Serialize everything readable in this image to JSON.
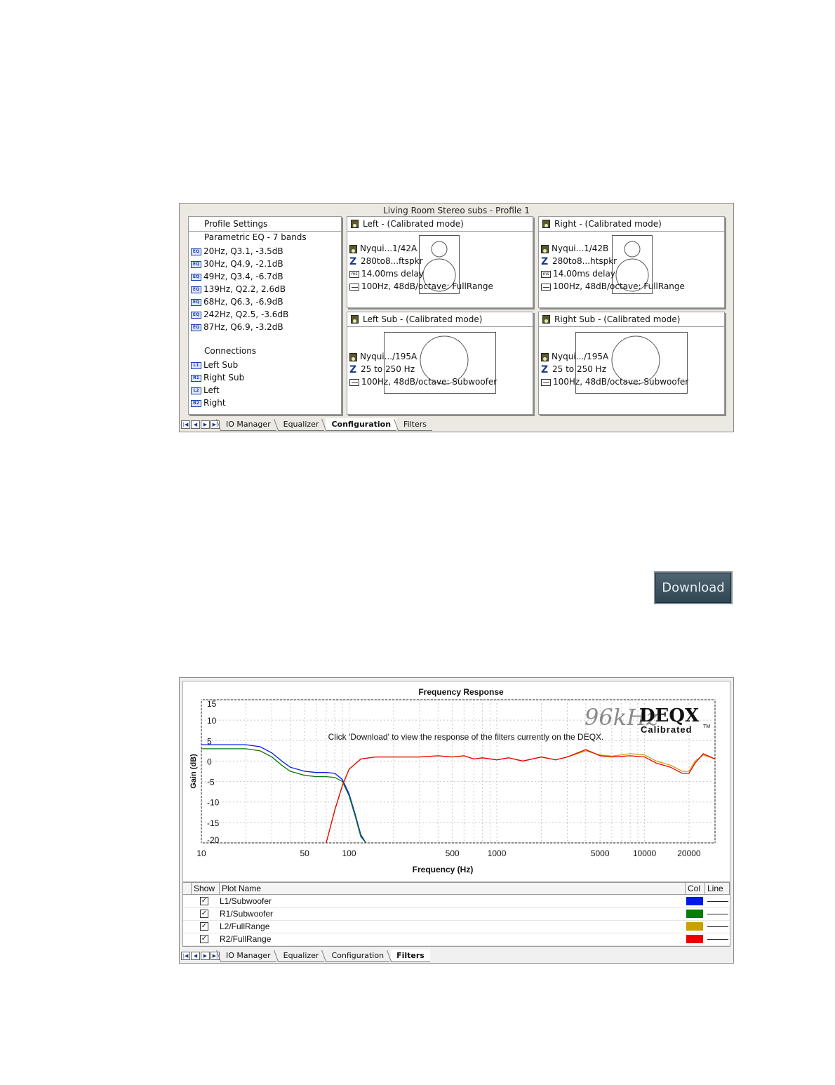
{
  "config_panel": {
    "title": "Living Room Stereo subs - Profile 1",
    "profile": {
      "header": "Profile Settings",
      "eq_title": "Parametric EQ - 7 bands",
      "eq_icon_label": "EQ",
      "eq_bands": [
        "20Hz, Q3.1, -3.5dB",
        "30Hz, Q4.9, -2.1dB",
        "49Hz, Q3.4, -6.7dB",
        "139Hz, Q2.2, 2.6dB",
        "68Hz, Q6.3, -6.9dB",
        "242Hz, Q2.5, -3.6dB",
        "87Hz, Q6.9, -3.2dB"
      ],
      "connections_title": "Connections",
      "connections": [
        {
          "tag": "L1",
          "label": "Left Sub"
        },
        {
          "tag": "R1",
          "label": "Right Sub"
        },
        {
          "tag": "L2",
          "label": "Left"
        },
        {
          "tag": "R2",
          "label": "Right"
        }
      ]
    },
    "left": {
      "title": "Left -  (Calibrated mode)",
      "speaker": "Nyqui...1/42A",
      "range": "280to8...ftspkr",
      "delay": "14.00ms delay",
      "filter": "100Hz, 48dB/octave: FullRange"
    },
    "right": {
      "title": "Right -  (Calibrated mode)",
      "speaker": "Nyqui...1/42B",
      "range": "280to8...htspkr",
      "delay": "14.00ms delay",
      "filter": "100Hz, 48dB/octave: FullRange"
    },
    "left_sub": {
      "title": "Left Sub -  (Calibrated mode)",
      "speaker": "Nyqui.../195A",
      "range": "25 to 250 Hz",
      "filter": "100Hz, 48dB/octave: Subwoofer"
    },
    "right_sub": {
      "title": "Right Sub -  (Calibrated mode)",
      "speaker": "Nyqui.../195A",
      "range": "25 to 250 Hz",
      "filter": "100Hz, 48dB/octave: Subwoofer"
    },
    "tabs": [
      "IO Manager",
      "Equalizer",
      "Configuration",
      "Filters"
    ],
    "active_tab": "Configuration"
  },
  "download_button": "Download",
  "freq_panel": {
    "logo_rate": "96kHz",
    "logo_brand": "DEQX",
    "logo_sub": "Calibrated",
    "logo_tm": "TM",
    "message": "Click 'Download' to view the response of the filters currently on the DEQX.",
    "grid_headers": {
      "show": "Show",
      "name": "Plot Name",
      "col": "Col",
      "line": "Line"
    },
    "check_mark": "✓",
    "tabs": [
      "IO Manager",
      "Equalizer",
      "Configuration",
      "Filters"
    ],
    "active_tab": "Filters"
  },
  "chart_data": {
    "type": "line",
    "title": "Frequency Response",
    "xlabel": "Frequency (Hz)",
    "ylabel": "Gain (dB)",
    "xscale": "log",
    "xlim": [
      10,
      30000
    ],
    "ylim": [
      -20,
      15
    ],
    "xticks": [
      10,
      50,
      100,
      500,
      1000,
      5000,
      10000,
      20000
    ],
    "yticks": [
      15,
      10,
      5,
      0,
      -5,
      -10,
      -15,
      -20
    ],
    "grid": true,
    "series": [
      {
        "name": "L1/Subwoofer",
        "color": "#0018f0",
        "x": [
          10,
          15,
          20,
          25,
          30,
          35,
          40,
          50,
          60,
          70,
          80,
          90,
          100,
          110,
          120,
          130
        ],
        "y": [
          4,
          4,
          4,
          3.5,
          2,
          0,
          -1.5,
          -2.5,
          -2.8,
          -2.8,
          -3,
          -4.5,
          -8,
          -13,
          -18,
          -20
        ]
      },
      {
        "name": "R1/Subwoofer",
        "color": "#0a7a0a",
        "x": [
          10,
          15,
          20,
          25,
          30,
          35,
          40,
          50,
          60,
          70,
          80,
          90,
          100,
          110,
          120,
          130
        ],
        "y": [
          3,
          3,
          3,
          2.5,
          1,
          -1,
          -2.5,
          -3.5,
          -3.8,
          -3.8,
          -4,
          -5,
          -8.5,
          -13.5,
          -18.5,
          -20
        ]
      },
      {
        "name": "L2/FullRange",
        "color": "#c8a000",
        "x": [
          70,
          80,
          90,
          100,
          120,
          150,
          200,
          300,
          400,
          500,
          600,
          700,
          800,
          1000,
          1200,
          1500,
          2000,
          2500,
          3000,
          4000,
          5000,
          6000,
          8000,
          10000,
          12000,
          15000,
          18000,
          20000,
          22000,
          25000,
          30000
        ],
        "y": [
          -20,
          -12,
          -6,
          -2,
          0.5,
          1,
          1,
          1,
          1.3,
          1,
          1.3,
          0.5,
          0.8,
          0.3,
          0.8,
          0,
          1,
          0.3,
          1,
          2.5,
          1.5,
          1.2,
          1.8,
          1.5,
          0,
          -1,
          -2.5,
          -2.5,
          0,
          1.5,
          0.5
        ]
      },
      {
        "name": "R2/FullRange",
        "color": "#e80000",
        "x": [
          70,
          80,
          90,
          100,
          120,
          150,
          200,
          300,
          400,
          500,
          600,
          700,
          800,
          1000,
          1200,
          1500,
          2000,
          2500,
          3000,
          4000,
          5000,
          6000,
          8000,
          10000,
          12000,
          15000,
          18000,
          20000,
          22000,
          25000,
          30000
        ],
        "y": [
          -20,
          -12,
          -6,
          -2,
          0.5,
          1,
          1,
          1,
          1.3,
          1,
          1.3,
          0.5,
          0.8,
          0.3,
          0.8,
          0,
          1,
          0.3,
          1,
          2.8,
          1.3,
          1,
          1.3,
          1,
          -0.5,
          -1.5,
          -3,
          -3,
          -0.5,
          1.8,
          0.5
        ]
      }
    ]
  }
}
